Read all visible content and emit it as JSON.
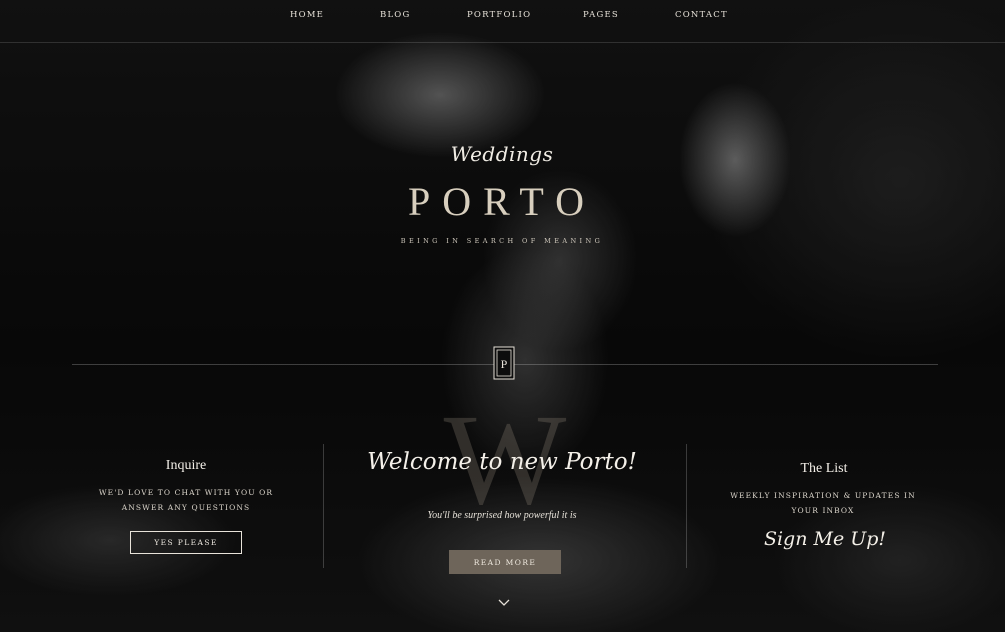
{
  "nav": {
    "items": [
      "HOME",
      "BLOG",
      "PORTFOLIO",
      "PAGES",
      "CONTACT"
    ]
  },
  "hero": {
    "script_title": "Weddings",
    "brand": "PORTO",
    "tagline": "BEING IN SEARCH OF MEANING",
    "emblem_letter": "P"
  },
  "inquire": {
    "title": "Inquire",
    "text_line1": "WE'D LOVE TO CHAT WITH YOU OR",
    "text_line2": "ANSWER ANY QUESTIONS",
    "button_label": "YES PLEASE"
  },
  "welcome": {
    "watermark_letter": "W",
    "heading": "Welcome to new Porto!",
    "subtext": "You'll be surprised how powerful it is",
    "button_label": "READ MORE"
  },
  "list": {
    "title": "The List",
    "text_line1": "WEEKLY INSPIRATION & UPDATES IN",
    "text_line2": "YOUR INBOX",
    "sign_up_label": "Sign Me Up!"
  },
  "icons": {
    "emblem": "monogram-frame-icon",
    "scroll": "chevron-down-icon"
  },
  "colors": {
    "accent_button": "#6e655a",
    "brand_text": "#d8cfbe"
  }
}
